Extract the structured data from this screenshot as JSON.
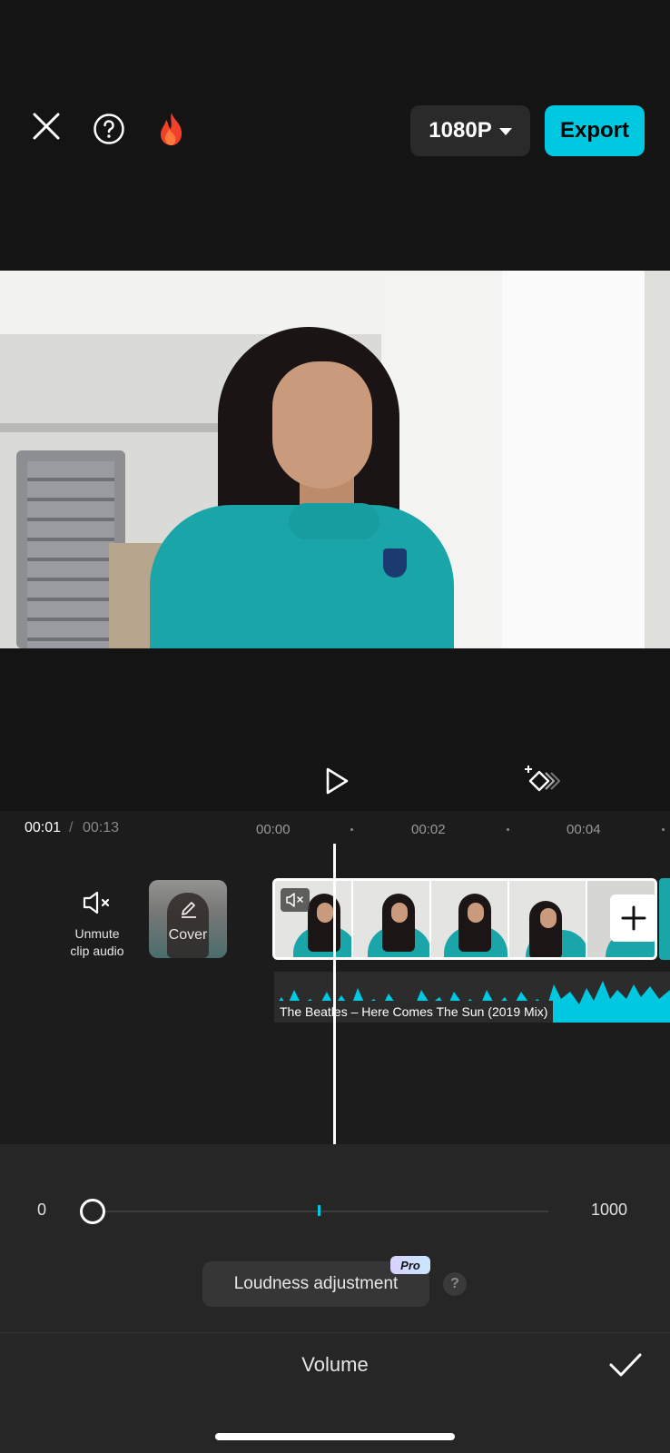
{
  "toolbar": {
    "close_icon": "close-icon",
    "help_icon": "help-icon",
    "trending_icon": "fire-icon",
    "resolution": "1080P",
    "export_label": "Export"
  },
  "player": {
    "play_icon": "play-icon",
    "keyframe_icon": "keyframe-icon"
  },
  "timeline": {
    "current_time": "00:01",
    "separator": "/",
    "total_time": "00:13",
    "ruler_ticks": [
      "00:00",
      "00:02",
      "00:04"
    ],
    "unmute_label_line1": "Unmute",
    "unmute_label_line2": "clip audio",
    "cover_label": "Cover",
    "audio_track_label": "The Beatles – Here Comes The Sun (2019 Mix)"
  },
  "volume_panel": {
    "min_label": "0",
    "max_label": "1000",
    "loudness_label": "Loudness adjustment",
    "pro_badge": "Pro",
    "help_glyph": "?",
    "title": "Volume"
  },
  "colors": {
    "accent": "#00c8e0",
    "background": "#141414",
    "panel": "#262626"
  }
}
